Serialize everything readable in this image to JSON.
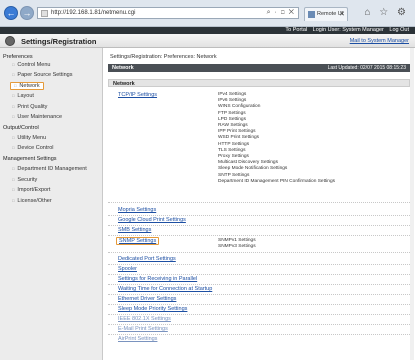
{
  "browser": {
    "url": "http://192.168.1.81/netmenu.cgi",
    "url_tools": "⌕ · ◻ ✕",
    "tab_label": "Remote UI",
    "tab_close": "✕",
    "chrome_icons": "⌂ ☆ ⚙"
  },
  "app_bar": {
    "portal_link": "To Portal",
    "login_user": "Login User: System Manager",
    "logout_link": "Log Out"
  },
  "header": {
    "title": "Settings/Registration",
    "mail_link": "Mail to System Manager"
  },
  "sidebar": {
    "groups": [
      {
        "heading": "Preferences",
        "items": [
          "Control Menu",
          "Paper Source Settings",
          "Network",
          "Layout",
          "Print Quality",
          "User Maintenance"
        ]
      },
      {
        "heading": "Output/Control",
        "items": [
          "Utility Menu",
          "Device Control"
        ]
      },
      {
        "heading": "Management Settings",
        "items": [
          "Department ID Management",
          "Security",
          "Import/Export",
          "License/Other"
        ]
      }
    ],
    "active": "Network"
  },
  "main": {
    "breadcrumb": "Settings/Registration: Preferences: Network",
    "section_title": "Network",
    "last_updated": "Last Updated: 02/07 2015 08:15:23",
    "subsection_title": "Network",
    "tcpip_link": "TCP/IP Settings",
    "tcpip_items": [
      "IPv4 Settings",
      "IPv6 Settings",
      "WINS Configuration",
      "FTP Settings",
      "LPD Settings",
      "RAW Settings",
      "IPP Print Settings",
      "WSD Print Settings",
      "HTTP Settings",
      "TLS Settings",
      "Proxy Settings",
      "Multicast Discovery Settings",
      "Sleep Mode Notification Settings",
      "SNTP Settings",
      "Department ID Management PIN Confirmation Settings"
    ],
    "mopria_link": "Mopria Settings",
    "gcp_link": "Google Cloud Print Settings",
    "smb_link": "SMB Settings",
    "snmp_link": "SNMP Settings",
    "snmp_items": [
      "SNMPv1 Settings",
      "SNMPv3 Settings"
    ],
    "lower_links": [
      "Dedicated Port Settings",
      "Spooler",
      "Settings for Receiving in Parallel",
      "Waiting Time for Connection at Startup",
      "Ethernet Driver Settings",
      "Sleep Mode Priority Settings",
      "IEEE 802.1X Settings",
      "E-Mail Print Settings",
      "AirPrint Settings"
    ]
  }
}
